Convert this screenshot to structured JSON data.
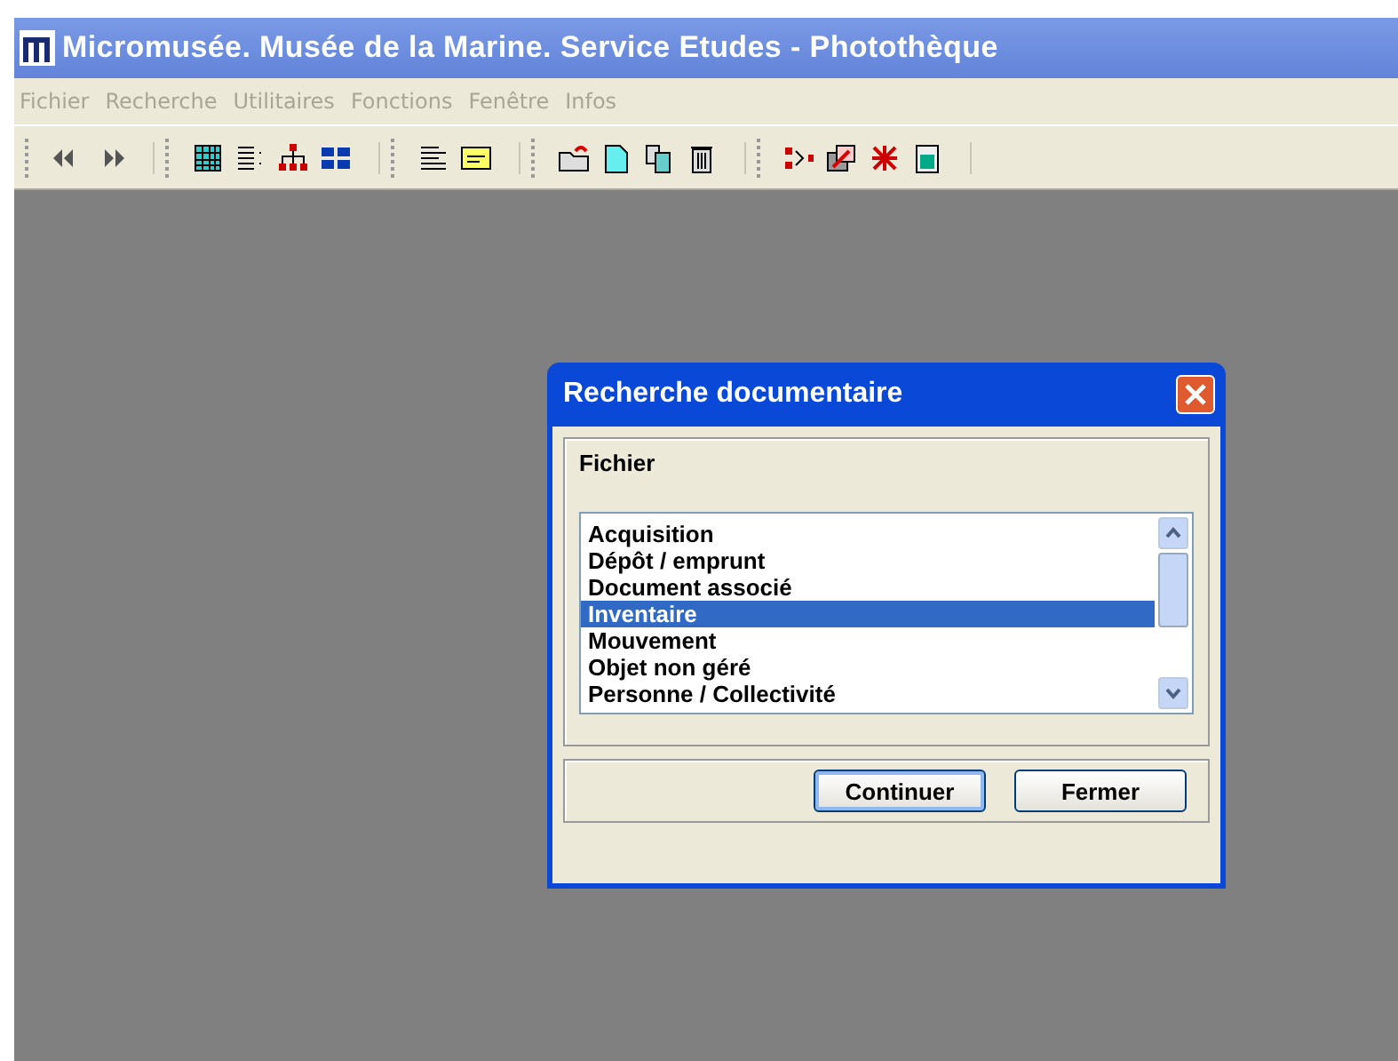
{
  "window": {
    "title": "Micromusée. Musée de la Marine. Service Etudes - Photothèque"
  },
  "menu": [
    {
      "label": "Fichier",
      "disabled": true
    },
    {
      "label": "Recherche",
      "disabled": true
    },
    {
      "label": "Utilitaires",
      "disabled": true
    },
    {
      "label": "Fonctions",
      "disabled": true
    },
    {
      "label": "Fenêtre",
      "disabled": true
    },
    {
      "label": "Infos",
      "disabled": true
    }
  ],
  "dialog": {
    "title": "Recherche documentaire",
    "group_label": "Fichier",
    "items": [
      {
        "label": "Acquisition",
        "selected": false
      },
      {
        "label": "Dépôt / emprunt",
        "selected": false
      },
      {
        "label": "Document associé",
        "selected": false
      },
      {
        "label": "Inventaire",
        "selected": true
      },
      {
        "label": "Mouvement",
        "selected": false
      },
      {
        "label": "Objet non géré",
        "selected": false
      },
      {
        "label": "Personne / Collectivité",
        "selected": false
      }
    ],
    "buttons": [
      {
        "label": "Continuer",
        "default": true
      },
      {
        "label": "Fermer",
        "default": false
      }
    ]
  }
}
